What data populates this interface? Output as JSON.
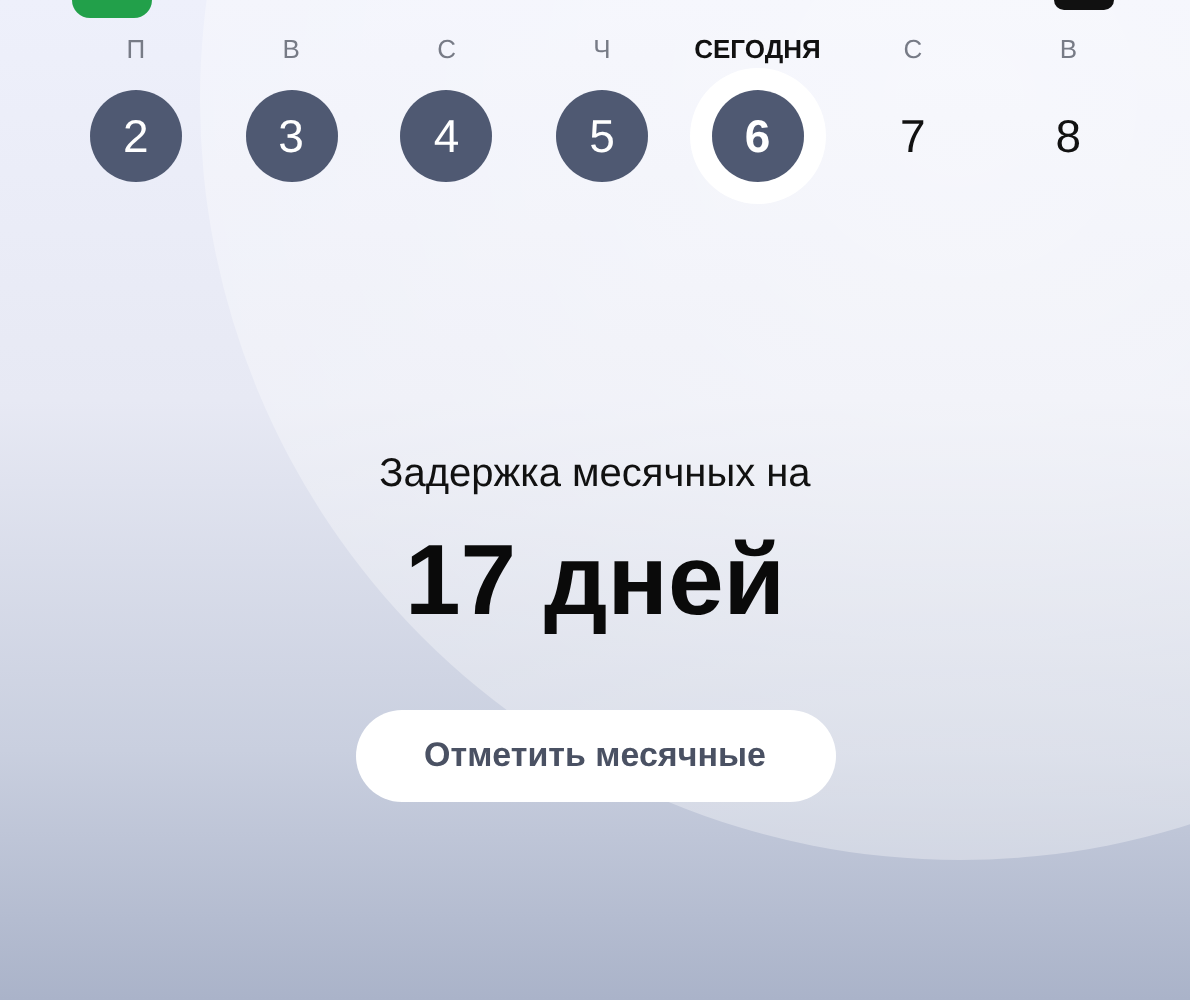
{
  "days": [
    {
      "weekday": "П",
      "date": "2",
      "marked": true,
      "selected": false
    },
    {
      "weekday": "В",
      "date": "3",
      "marked": true,
      "selected": false
    },
    {
      "weekday": "С",
      "date": "4",
      "marked": true,
      "selected": false
    },
    {
      "weekday": "Ч",
      "date": "5",
      "marked": true,
      "selected": false
    },
    {
      "weekday": "СЕГОДНЯ",
      "date": "6",
      "marked": true,
      "selected": true
    },
    {
      "weekday": "С",
      "date": "7",
      "marked": false,
      "selected": false
    },
    {
      "weekday": "В",
      "date": "8",
      "marked": false,
      "selected": false
    }
  ],
  "status": {
    "caption": "Задержка месячных на",
    "value": "17 дней"
  },
  "action_button": "Отметить месячные"
}
